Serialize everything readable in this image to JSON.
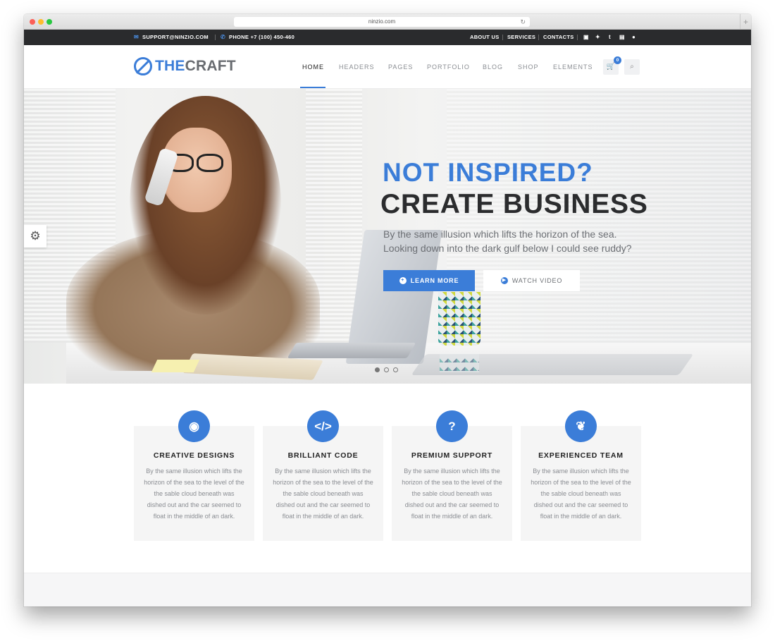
{
  "browser": {
    "url": "ninzio.com"
  },
  "topbar": {
    "email": "SUPPORT@NINZIO.COM",
    "phone": "PHONE +7 (100) 450-460",
    "links": [
      "ABOUT US",
      "SERVICES",
      "CONTACTS"
    ],
    "social_icons": [
      "facebook-icon",
      "twitter-icon",
      "tumblr-icon",
      "linkedin-icon",
      "flickr-icon"
    ]
  },
  "header": {
    "logo_the": "THE",
    "logo_craft": "CRAFT",
    "nav": [
      "HOME",
      "HEADERS",
      "PAGES",
      "PORTFOLIO",
      "BLOG",
      "SHOP",
      "ELEMENTS"
    ],
    "active_nav": "HOME",
    "cart_count": "0"
  },
  "hero": {
    "title_line1": "NOT INSPIRED?",
    "title_line2": "CREATE BUSINESS",
    "subtitle_line1": "By the same illusion which lifts the horizon of the sea.",
    "subtitle_line2": "Looking down into the dark gulf below I could see ruddy?",
    "primary_button": "LEARN MORE",
    "secondary_button": "WATCH VIDEO",
    "slides": 3,
    "active_slide": 1
  },
  "features": [
    {
      "icon": "eye-icon",
      "title": "CREATIVE DESIGNS",
      "text": "By the same illusion which lifts the horizon of the sea to the level of the the sable cloud beneath was dished out and the car seemed to float in the middle of an dark."
    },
    {
      "icon": "code-icon",
      "title": "BRILLIANT CODE",
      "text": "By the same illusion which lifts the horizon of the sea to the level of the the sable cloud beneath was dished out and the car seemed to float in the middle of an dark."
    },
    {
      "icon": "question-icon",
      "title": "PREMIUM SUPPORT",
      "text": "By the same illusion which lifts the horizon of the sea to the level of the the sable cloud beneath was dished out and the car seemed to float in the middle of an dark."
    },
    {
      "icon": "leaf-icon",
      "title": "EXPERIENCED TEAM",
      "text": "By the same illusion which lifts the horizon of the sea to the level of the the sable cloud beneath was dished out and the car seemed to float in the middle of an dark."
    }
  ],
  "colors": {
    "accent": "#3b7dd8",
    "topbar_bg": "#2a2b2d",
    "card_bg": "#f5f5f5"
  }
}
